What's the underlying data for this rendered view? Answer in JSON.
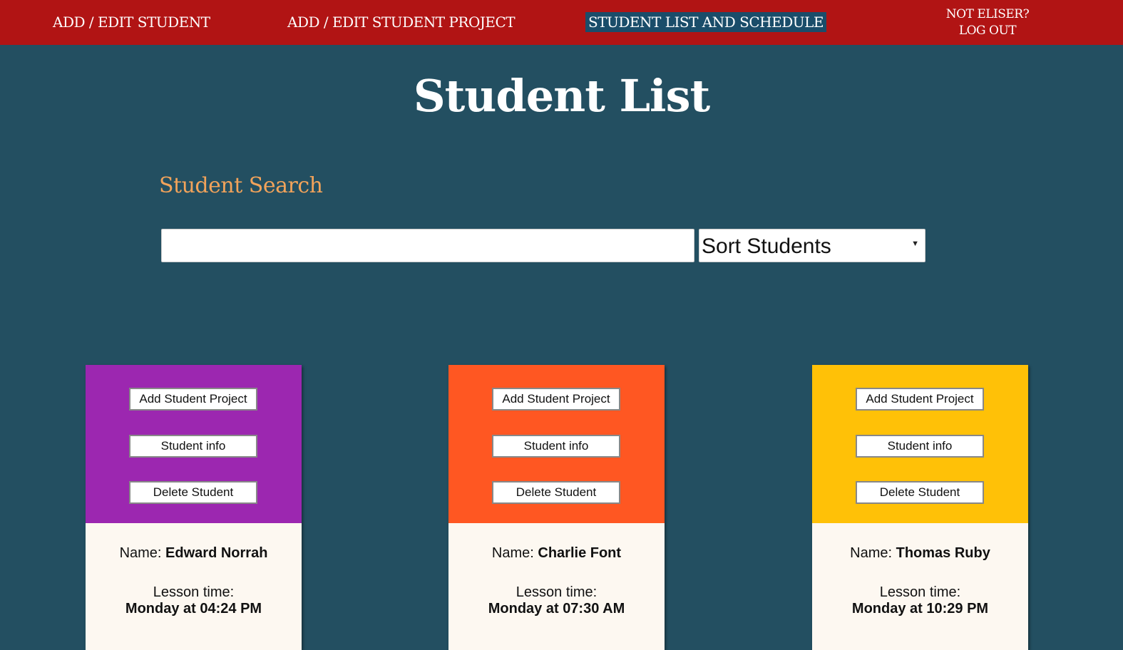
{
  "nav": {
    "items": [
      {
        "label": "ADD / EDIT STUDENT",
        "active": false
      },
      {
        "label": "ADD / EDIT STUDENT PROJECT",
        "active": false
      },
      {
        "label": "STUDENT LIST AND SCHEDULE",
        "active": true
      }
    ],
    "user_prompt": "NOT ELISER?",
    "logout_label": "LOG OUT"
  },
  "page": {
    "title": "Student List",
    "search_title": "Student Search",
    "search_value": "",
    "sort_label": "Sort Students"
  },
  "card_buttons": {
    "add_project": "Add Student Project",
    "info": "Student info",
    "delete": "Delete Student"
  },
  "labels": {
    "name": "Name: ",
    "lesson_time": "Lesson time:"
  },
  "students": [
    {
      "name": "Edward Norrah",
      "lesson_time": "Monday at 04:24 PM",
      "color": "#9c27b0"
    },
    {
      "name": "Charlie Font",
      "lesson_time": "Monday at 07:30 AM",
      "color": "#ff5722"
    },
    {
      "name": "Thomas Ruby",
      "lesson_time": "Monday at 10:29 PM",
      "color": "#ffc107"
    }
  ]
}
